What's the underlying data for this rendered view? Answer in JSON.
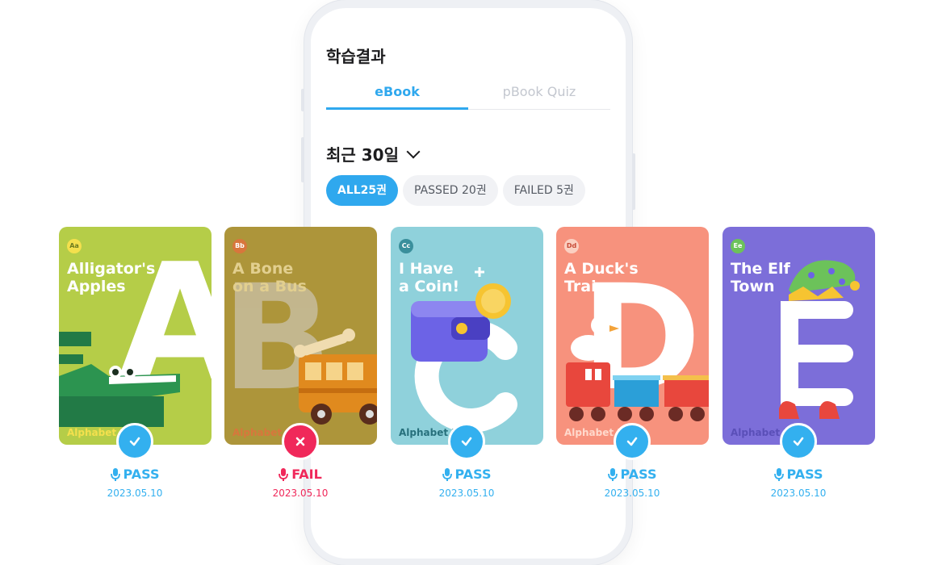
{
  "screen": {
    "title": "학습결과",
    "tabs": [
      {
        "label": "eBook",
        "active": true
      },
      {
        "label": "pBook Quiz",
        "active": false
      }
    ],
    "period": "최근 30일",
    "filters": [
      {
        "label": "ALL25권",
        "active": true
      },
      {
        "label": "PASSED 20권",
        "active": false
      },
      {
        "label": "FAILED 5권",
        "active": false
      }
    ]
  },
  "books": [
    {
      "badge": "Aa",
      "title": "Alligator's\nApples",
      "letter": "A",
      "brand": "Alphabet P",
      "result": "PASS",
      "date": "2023.05.10",
      "bg": "#b5cd48"
    },
    {
      "badge": "Bb",
      "title": "A Bone\non a Bus",
      "letter": "B",
      "brand": "Alphabet P",
      "result": "FAIL",
      "date": "2023.05.10",
      "bg": "#ad953a"
    },
    {
      "badge": "Cc",
      "title": "I Have\na Coin!",
      "letter": "C",
      "brand": "Alphabet P",
      "result": "PASS",
      "date": "2023.05.10",
      "bg": "#8fd1db"
    },
    {
      "badge": "Dd",
      "title": "A Duck's\nTrain",
      "letter": "D",
      "brand": "Alphabet P",
      "result": "PASS",
      "date": "2023.05.10",
      "bg": "#f7927d"
    },
    {
      "badge": "Ee",
      "title": "The Elf\nTown",
      "letter": "E",
      "brand": "Alphabet P",
      "result": "PASS",
      "date": "2023.05.10",
      "bg": "#7c6ed9"
    }
  ],
  "colors": {
    "accent": "#2fa8ee",
    "pass": "#33b0ef",
    "fail": "#f0285a"
  }
}
